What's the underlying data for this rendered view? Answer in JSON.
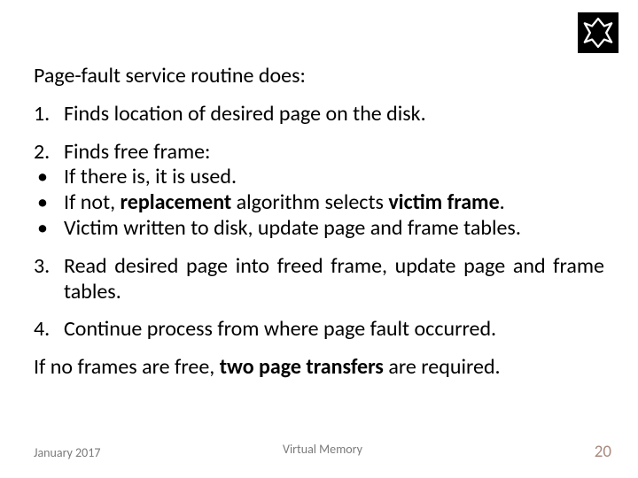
{
  "logo": {
    "alt": "Technion logo"
  },
  "heading": "Page-fault service routine does:",
  "items": [
    {
      "num": "1.",
      "text": "Finds location of desired page on the disk."
    },
    {
      "num": "2.",
      "text": "Finds free frame:",
      "sub": [
        "If there is, it is used.",
        "If not, <b>replacement</b> algorithm selects <b>victim frame</b>.",
        "Victim written to disk, update page and frame tables."
      ]
    },
    {
      "num": "3.",
      "text_html": "Read desired page into freed frame, update page and frame tables.",
      "justify": true
    },
    {
      "num": "4.",
      "text": "Continue process from where page fault occurred."
    }
  ],
  "closing_html": "If no frames are free, <b>two page transfers</b> are required.",
  "footer": {
    "left": "January 2017",
    "center": "Virtual Memory",
    "page": "20"
  }
}
